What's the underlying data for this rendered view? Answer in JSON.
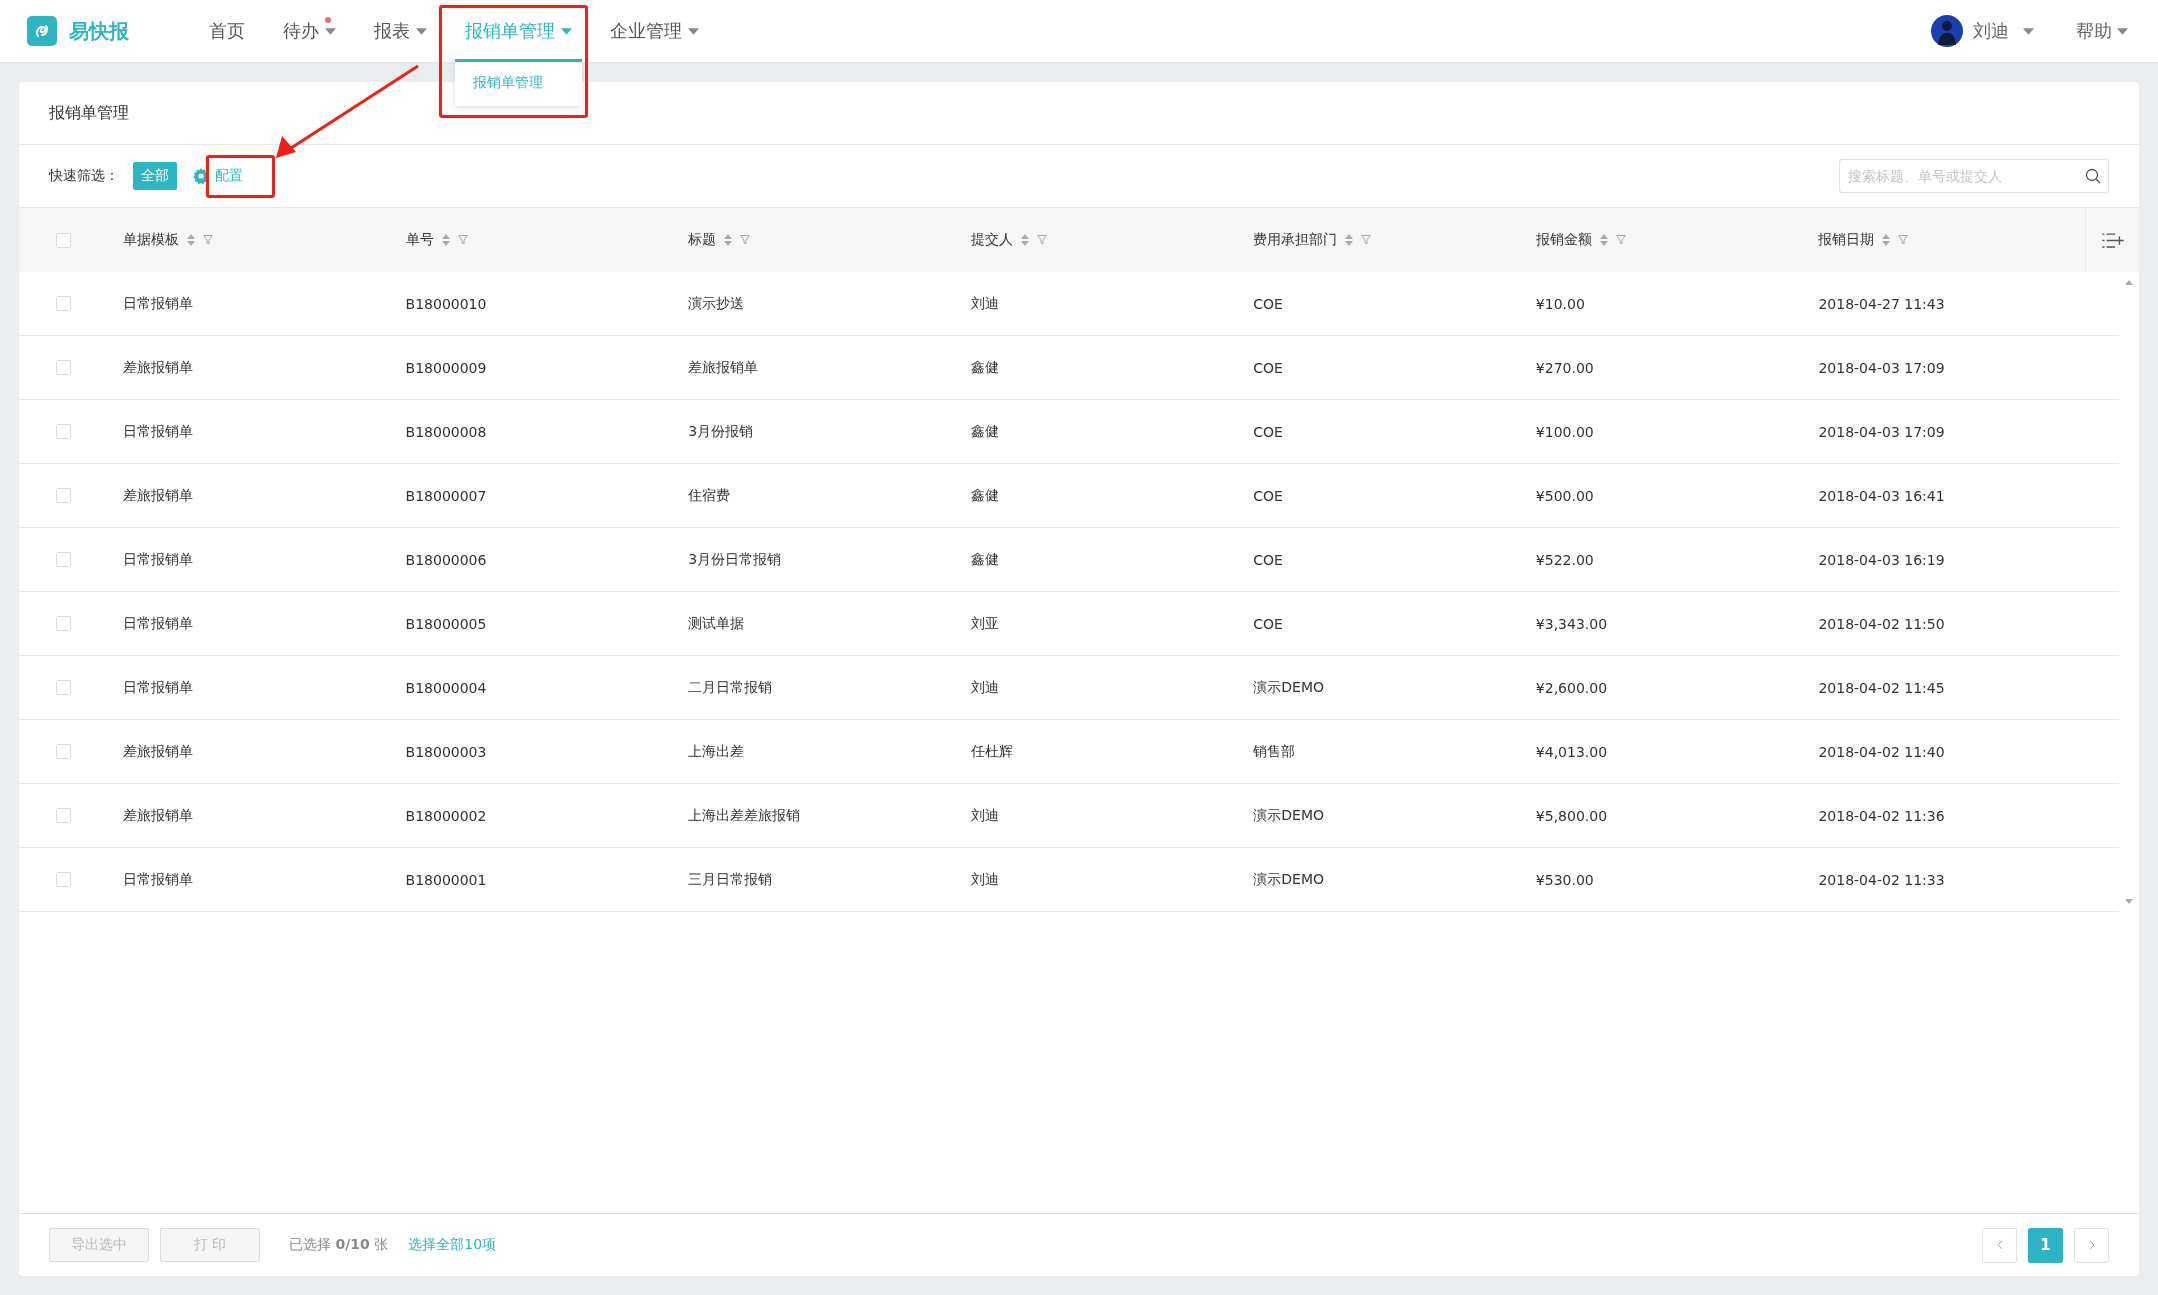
{
  "app": {
    "name": "易快报"
  },
  "nav": [
    {
      "label": "首页",
      "has_dropdown": false,
      "badge": false,
      "selected": false
    },
    {
      "label": "待办",
      "has_dropdown": true,
      "badge": true,
      "selected": false
    },
    {
      "label": "报表",
      "has_dropdown": true,
      "badge": false,
      "selected": false
    },
    {
      "label": "报销单管理",
      "has_dropdown": true,
      "badge": false,
      "selected": true
    },
    {
      "label": "企业管理",
      "has_dropdown": true,
      "badge": false,
      "selected": false
    }
  ],
  "nav_menu": {
    "items": [
      "报销单管理"
    ]
  },
  "user": {
    "name": "刘迪"
  },
  "help": {
    "label": "帮助"
  },
  "page_title": "报销单管理",
  "quick_filter": {
    "label": "快速筛选：",
    "options": [
      {
        "label": "全部",
        "selected": true
      }
    ],
    "config": "配置"
  },
  "search": {
    "placeholder": "搜索标题、单号或提交人"
  },
  "table": {
    "select_all_checked": false,
    "columns": [
      "单据模板",
      "单号",
      "标题",
      "提交人",
      "费用承担部门",
      "报销金额",
      "报销日期"
    ],
    "rows": [
      {
        "checked": false,
        "cells": [
          "日常报销单",
          "B18000010",
          "演示抄送",
          "刘迪",
          "COE",
          "¥10.00",
          "2018-04-27 11:43"
        ]
      },
      {
        "checked": false,
        "cells": [
          "差旅报销单",
          "B18000009",
          "差旅报销单",
          "鑫健",
          "COE",
          "¥270.00",
          "2018-04-03 17:09"
        ]
      },
      {
        "checked": false,
        "cells": [
          "日常报销单",
          "B18000008",
          "3月份报销",
          "鑫健",
          "COE",
          "¥100.00",
          "2018-04-03 17:09"
        ]
      },
      {
        "checked": false,
        "cells": [
          "差旅报销单",
          "B18000007",
          "住宿费",
          "鑫健",
          "COE",
          "¥500.00",
          "2018-04-03 16:41"
        ]
      },
      {
        "checked": false,
        "cells": [
          "日常报销单",
          "B18000006",
          "3月份日常报销",
          "鑫健",
          "COE",
          "¥522.00",
          "2018-04-03 16:19"
        ]
      },
      {
        "checked": false,
        "cells": [
          "日常报销单",
          "B18000005",
          "测试单据",
          "刘亚",
          "COE",
          "¥3,343.00",
          "2018-04-02 11:50"
        ]
      },
      {
        "checked": false,
        "cells": [
          "日常报销单",
          "B18000004",
          "二月日常报销",
          "刘迪",
          "演示DEMO",
          "¥2,600.00",
          "2018-04-02 11:45"
        ]
      },
      {
        "checked": false,
        "cells": [
          "差旅报销单",
          "B18000003",
          "上海出差",
          "任杜辉",
          "销售部",
          "¥4,013.00",
          "2018-04-02 11:40"
        ]
      },
      {
        "checked": false,
        "cells": [
          "差旅报销单",
          "B18000002",
          "上海出差差旅报销",
          "刘迪",
          "演示DEMO",
          "¥5,800.00",
          "2018-04-02 11:36"
        ]
      },
      {
        "checked": false,
        "cells": [
          "日常报销单",
          "B18000001",
          "三月日常报销",
          "刘迪",
          "演示DEMO",
          "¥530.00",
          "2018-04-02 11:33"
        ]
      }
    ]
  },
  "footer": {
    "buttons": [
      {
        "label": "导出选中",
        "disabled": true
      },
      {
        "label": "打 印",
        "disabled": true
      }
    ],
    "selection": "已选择 **0/10** 张",
    "select_all_link": "选择全部10项",
    "pages": [
      {
        "label": "1",
        "selected": true
      }
    ]
  }
}
